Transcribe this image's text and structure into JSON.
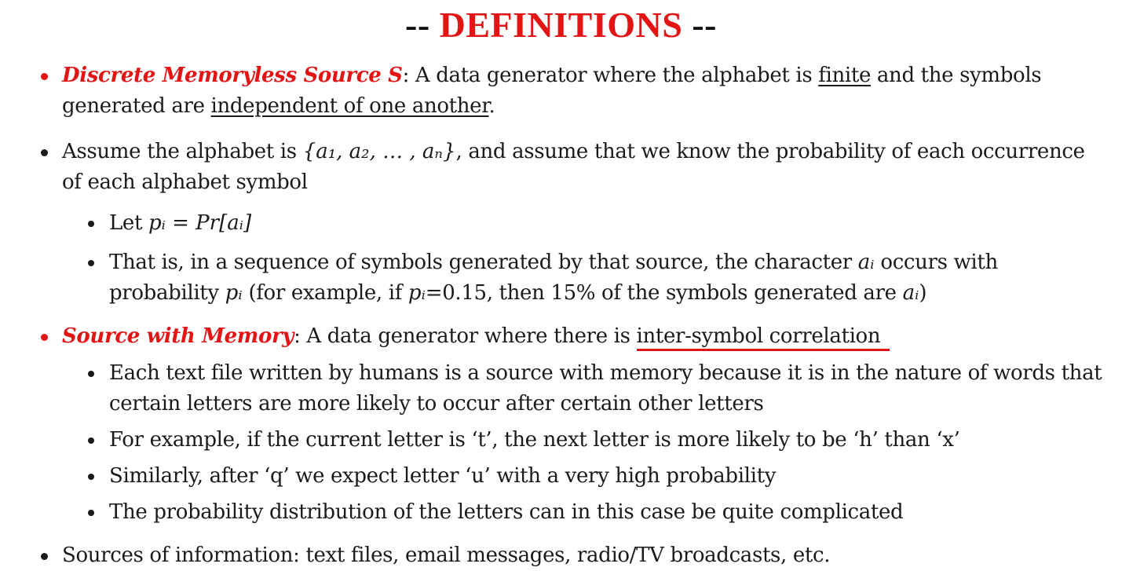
{
  "title": {
    "dash_left": "--",
    "word": "DEFINITIONS",
    "dash_right": "--"
  },
  "b1": {
    "term": "Discrete Memoryless Source S",
    "t1": ": A data generator where the alphabet is ",
    "u1": "finite",
    "t2": " and the symbols generated are ",
    "u2": "independent of one another",
    "t3": "."
  },
  "b2": {
    "t1": "Assume the alphabet is ",
    "math": "{a₁, a₂, … , aₙ}",
    "t2": ", and assume that we know the probability of each occurrence of each alphabet symbol"
  },
  "b2a": {
    "t1": "Let ",
    "math": "pᵢ = Pr[aᵢ]"
  },
  "b2b": {
    "t1": "That is, in a sequence of symbols generated by that source, the character ",
    "m1": "aᵢ",
    "t2": " occurs with probability ",
    "m2": "pᵢ",
    "t3": " (for example, if ",
    "m3": "pᵢ",
    "t4": "=0.15, then 15% of the symbols generated are ",
    "m4": "aᵢ",
    "t5": ")"
  },
  "b3": {
    "term": "Source with Memory",
    "t1": ": A data generator where there is ",
    "u1": "inter-symbol correlation"
  },
  "b3a": "Each text file written by humans is a source with memory because it is in the nature of words that certain letters are more likely to occur after certain other letters",
  "b3b": "For example, if the current letter is ‘t’, the next letter is more likely to be ‘h’ than ‘x’",
  "b3c": "Similarly, after ‘q’ we expect letter ‘u’ with a very high probability",
  "b3d": "The probability distribution of the letters can in this case be quite complicated",
  "b4": "Sources of information: text files, email messages, radio/TV broadcasts, etc.",
  "colors": {
    "accent": "#e31414",
    "text": "#1a1a1a"
  }
}
